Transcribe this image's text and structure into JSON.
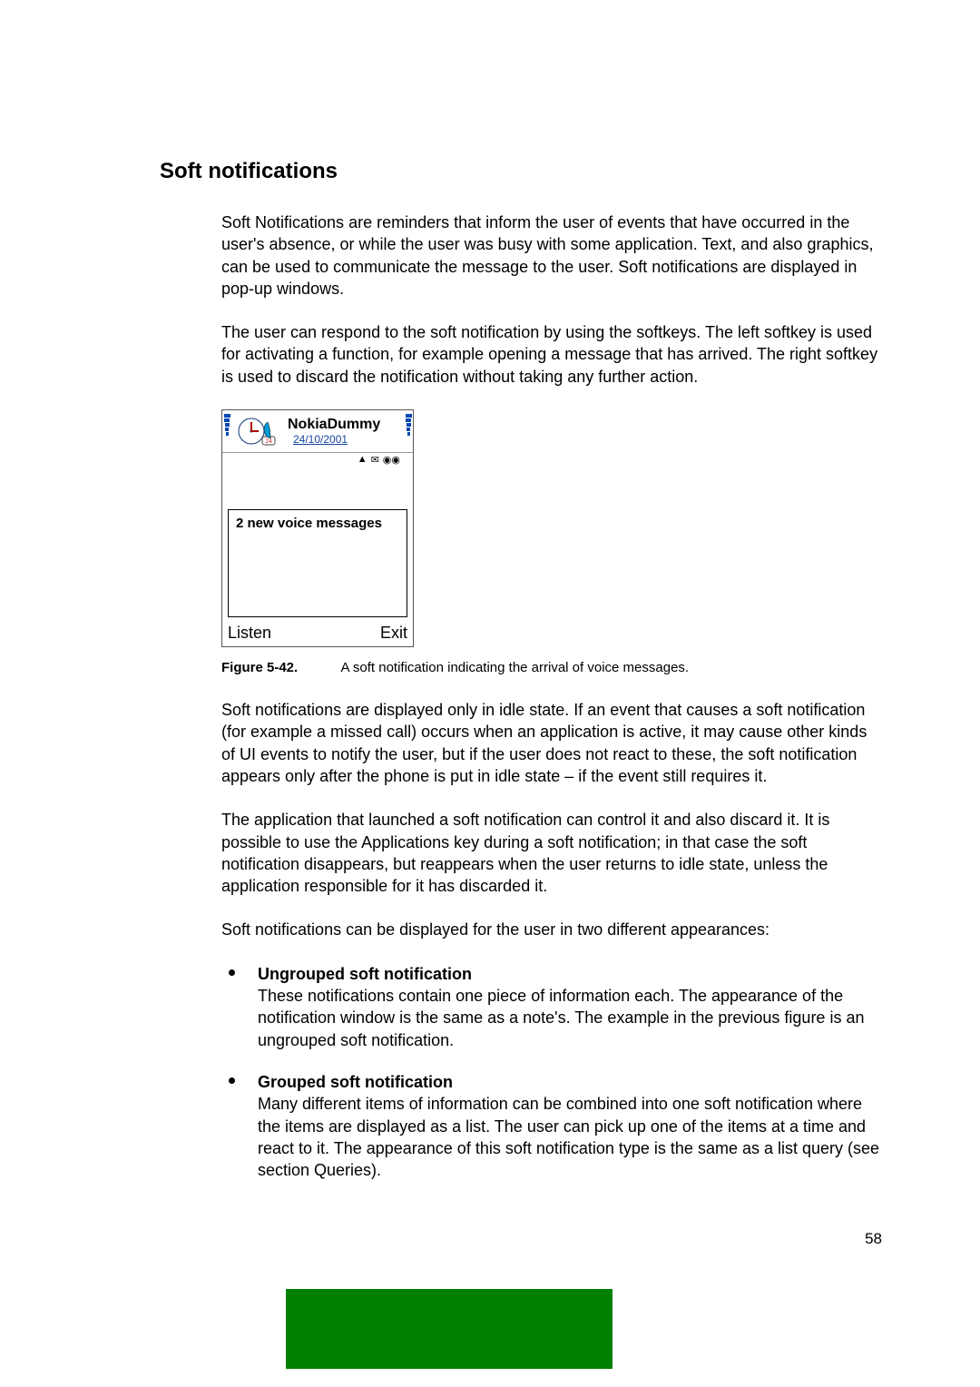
{
  "heading": "Soft notifications",
  "para1": "Soft Notifications are reminders that inform the user of events that have occurred in the user's absence, or while the user was busy with some application. Text, and also graphics, can be used to communicate the message to the user. Soft notifications are displayed in pop-up windows.",
  "para2": "The user can respond to the soft notification by using the softkeys. The left softkey is used for activating a function, for example opening a message that has arrived. The right softkey is used to discard the notification without taking any further action.",
  "phone": {
    "title": "NokiaDummy",
    "date": "24/10/2001",
    "notification": "2 new voice messages",
    "left_softkey": "Listen",
    "right_softkey": "Exit"
  },
  "figure": {
    "label": "Figure 5-42.",
    "caption": "A soft notification indicating the arrival of voice messages."
  },
  "para3": "Soft notifications are displayed only in idle state. If an event that causes a soft notification (for example a missed call) occurs when an application is active, it may cause other kinds of UI events to notify the user, but if the user does not react to these, the soft notification appears only after the phone is put in idle state – if the event still requires it.",
  "para4": "The application that launched a soft notification can control it and also discard it. It is possible to use the Applications key during a soft notification; in that case the soft notification disappears, but reappears when the user returns to idle state, unless the application responsible for it has discarded it.",
  "para5": "Soft notifications can be displayed for the user in two different appearances:",
  "bullets": [
    {
      "title": "Ungrouped soft notification",
      "body": "These notifications contain one piece of information each. The appearance of the notification window is the same as a note's. The example in the previous figure is an ungrouped soft notification."
    },
    {
      "title": "Grouped soft notification",
      "body": "Many different items of information can be combined into one soft notification where the items are displayed as a list. The user can pick up one of the items at a time and react to it. The appearance of this soft notification type is the same as a list query (see section Queries)."
    }
  ],
  "page_number": "58"
}
